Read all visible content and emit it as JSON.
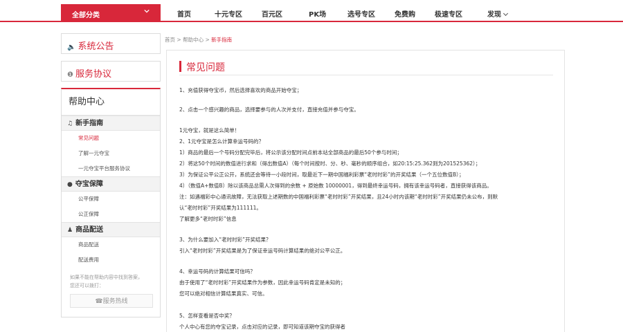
{
  "topnav": {
    "category_button": "全部分类",
    "items": [
      "首页",
      "十元专区",
      "百元区",
      "PK场",
      "选号专区",
      "免费购",
      "极速专区",
      "发现"
    ]
  },
  "sidebar": {
    "notice": "系统公告",
    "agreement": "服务协议",
    "help_title": "帮助中心",
    "groups": [
      {
        "title": "新手指南",
        "items": [
          "常见问题",
          "了解一元夺宝",
          "一元夺宝平台服务协议"
        ]
      },
      {
        "title": "夺宝保障",
        "items": [
          "公平保障",
          "公正保障"
        ]
      },
      {
        "title": "商品配送",
        "items": [
          "商品配送",
          "配送费用"
        ]
      }
    ],
    "note_line1": "如果不能在帮助内容中找到答案，",
    "note_line2": "您还可以拨打：",
    "hotline": "服务热线"
  },
  "breadcrumb": {
    "home": "首页",
    "sep": ">",
    "help": "帮助中心",
    "current": "新手指南"
  },
  "main": {
    "title": "常见问题",
    "lines": [
      "1、充值获得夺宝币，然后选择喜欢的商品开始夺宝；",
      "2、点击一个感兴趣的商品，选择要参与的人次并支付，直接充值并参与夺宝。",
      "1元夺宝，就是这么简单！",
      "2、1元夺宝是怎么计算幸运号码的？",
      "1）商品的最后一个号码分配完毕后，将公示该分配时间点前本站全部商品的最后50个参与时间；",
      "2）将这50个时间的数值进行求和（得出数值A）（每个时间按时、分、秒、毫秒的顺序组合，如20:15:25.362则为201525362）；",
      "3）为保证公平公正公开，系统还会等待一小段时间，取最近下一期中国福利彩票“老时时彩”的开奖结果（一个五位数值B）；",
      "4）（数值A+数值B）除以该商品总需人次得到的余数 + 原始数 10000001，得到最终幸运号码，拥有该幸运号码者，直接获得该商品。",
      "注：如遇福彩中心通讯故障，无法获取上述期数的中国福利彩票“老时时彩”开奖结果，且24小时内该期“老时时彩”开奖结果仍未公布，则默",
      "认“老时时彩”开奖结果为111111。",
      "了解更多“老时时彩”信息",
      "3、为什么要加入“老时时彩”开奖结果？",
      "引入“老时时彩”开奖结果是为了保证幸运号码计算结果的绝对公平公正。",
      "4、幸运号码的计算结果可信吗？",
      "由于使用了“老时时彩”开奖结果作为参数，因此幸运号码肯定是未知的；",
      "您可以绝对相信计算结果真实、可信。",
      "5、怎样查看是否中奖？",
      "个人中心有您的夺宝记录，点击对应的记录，即可知道该期夺宝的获得者"
    ]
  },
  "colors": {
    "accent": "#d8273a",
    "muted": "#999999",
    "border": "#dcdcdc"
  },
  "icons": [
    "chevron-down-icon",
    "speaker-icon",
    "info-icon",
    "headset-icon",
    "lock-icon",
    "user-icon"
  ]
}
